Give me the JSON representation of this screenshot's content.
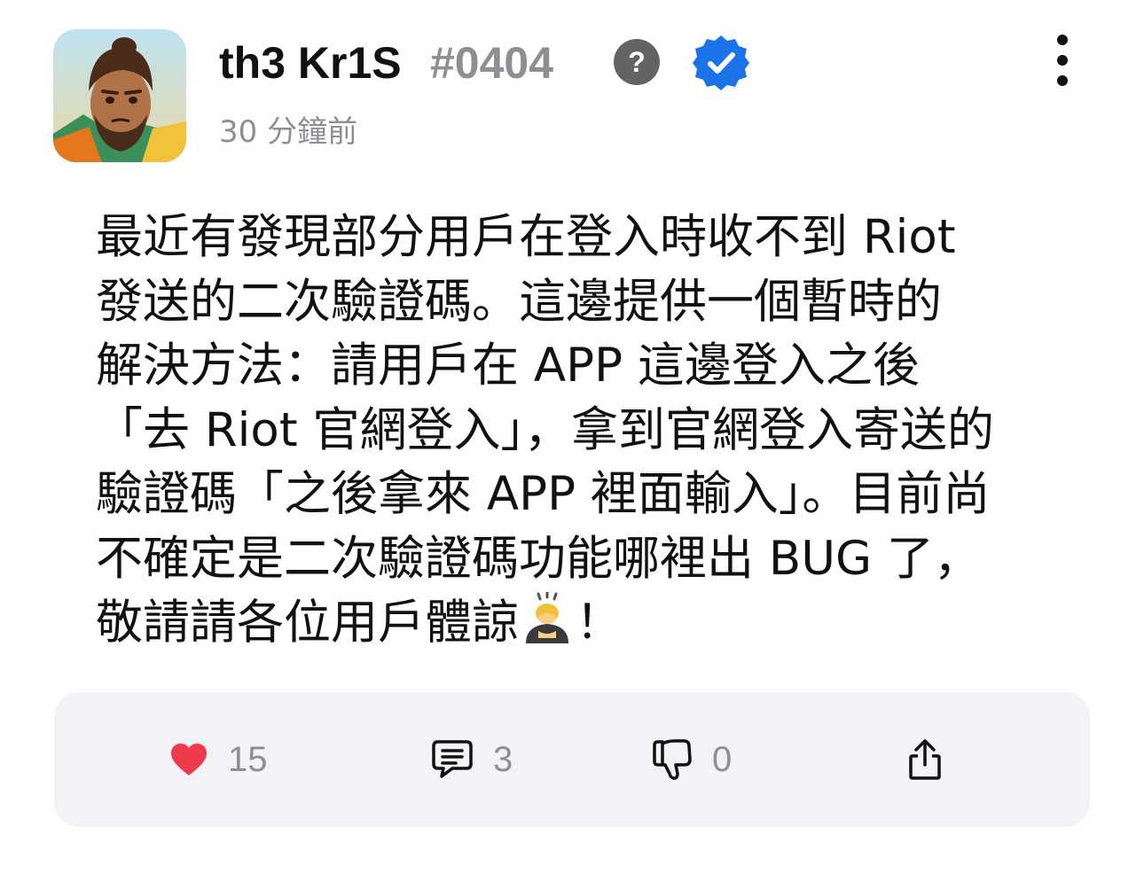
{
  "post": {
    "author": {
      "name": "th3 Kr1S",
      "tag": "#0404",
      "avatar_icon": "avatar-icon",
      "badges": [
        "help-icon",
        "verified-icon"
      ],
      "verified_color": "#1a73e8"
    },
    "time_ago": "30 分鐘前",
    "body_lines": [
      "最近有發現部分用戶在登入時收不到 Riot",
      "發送的二次驗證碼。這邊提供一個暫時的",
      "解決方法：請用戶在 APP 這邊登入之後",
      "「去 Riot 官網登入」，拿到官網登入寄送的",
      "驗證碼「之後拿來 APP 裡面輸入」。目前尚",
      "不確定是二次驗證碼功能哪裡出 BUG 了，",
      "敬請請各位用戶體諒"
    ],
    "body_tail": "！",
    "emoji_icon": "bowing-person-icon"
  },
  "actions": {
    "likes": "15",
    "comments": "3",
    "dislikes": "0",
    "like_color": "#ee3a4a"
  }
}
